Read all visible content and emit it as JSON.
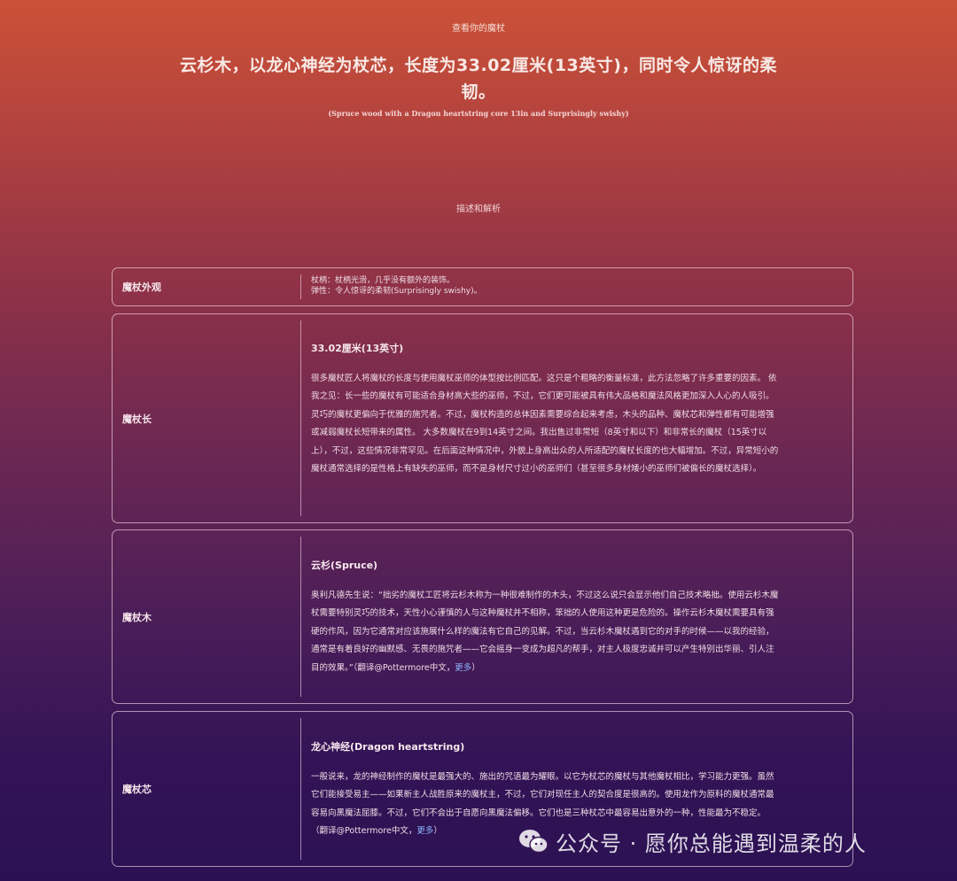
{
  "header": {
    "top_label": "查看你的魔杖",
    "title": "云杉木，以龙心神经为杖芯，长度为33.02厘米(13英寸)，同时令人惊讶的柔韧。",
    "subtitle": "(Spruce wood with a Dragon heartstring core 13in and Surprisingly swishy)"
  },
  "section": {
    "label": "描述和解析"
  },
  "cards": [
    {
      "label": "魔杖外观",
      "lines": [
        "杖柄：杖柄光滑，几乎没有额外的装饰。",
        "弹性：令人惊讶的柔韧(Surprisingly swishy)。"
      ]
    },
    {
      "label": "魔杖长",
      "heading": "33.02厘米(13英寸)",
      "text": "很多魔杖匠人将魔杖的长度与使用魔杖巫师的体型按比例匹配。这只是个粗略的衡量标准，此方法忽略了许多重要的因素。 依我之见：长一些的魔杖有可能适合身材高大些的巫师，不过，它们更可能被具有伟大品格和魔法风格更加深入人心的人吸引。灵巧的魔杖更偏向于优雅的施咒者。不过，魔杖构造的总体因素需要综合起来考虑，木头的品种、魔杖芯和弹性都有可能增强或减弱魔杖长短带来的属性。 大多数魔杖在9到14英寸之间。我出售过非常短（8英寸和以下）和非常长的魔杖（15英寸以上），不过，这些情况非常罕见。在后面这种情况中，外貌上身高出众的人所适配的魔杖长度的也大幅增加。不过，异常短小的魔杖通常选择的是性格上有缺失的巫师，而不是身材尺寸过小的巫师们（甚至很多身材矮小的巫师们被偏长的魔杖选择）。"
    },
    {
      "label": "魔杖木",
      "heading": "云杉(Spruce)",
      "text": "奥利凡德先生说：“拙劣的魔杖工匠将云杉木称为一种很难制作的木头，不过这么说只会显示他们自己技术略拙。使用云杉木魔杖需要特别灵巧的技术，天性小心谨慎的人与这种魔杖并不相称，笨拙的人使用这种更是危险的。操作云杉木魔杖需要具有强硬的作风，因为它通常对应该施展什么样的魔法有它自己的见解。不过，当云杉木魔杖遇到它的对手的时候——以我的经验，通常是有着良好的幽默感、无畏的施咒者——它会摇身一变成为超凡的帮手，对主人极度忠诚并可以产生特别出华丽、引人注目的效果。”（翻译@Pottermore中文，",
      "more": "更多",
      "tail": "）"
    },
    {
      "label": "魔杖芯",
      "heading": "龙心神经(Dragon heartstring)",
      "text": "一般说来，龙的神经制作的魔杖是最强大的、施出的咒语最为耀眼。以它为杖芯的魔杖与其他魔杖相比，学习能力更强。虽然它们能接受易主——如果新主人战胜原来的魔杖主，不过，它们对现任主人的契合度是很高的。使用龙作为原料的魔杖通常最容易向黑魔法屈膝。不过，它们不会出于自愿向黑魔法偏移。它们也是三种杖芯中最容易出意外的一种，性能最为不稳定。 （翻译@Pottermore中文，",
      "more": "更多",
      "tail": "）"
    }
  ],
  "watermark": {
    "text": "公众号 · 愿你总能遇到温柔的人",
    "icon": "wechat-icon"
  }
}
